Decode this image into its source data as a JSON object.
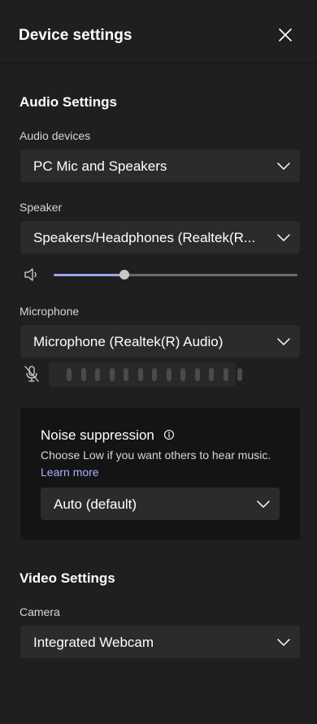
{
  "header": {
    "title": "Device settings",
    "close_icon": "close-icon"
  },
  "audio": {
    "heading": "Audio Settings",
    "devices": {
      "label": "Audio devices",
      "value": "PC Mic and Speakers"
    },
    "speaker": {
      "label": "Speaker",
      "value": "Speakers/Headphones (Realtek(R...",
      "volume_level": 0.29,
      "icon": "speaker-icon"
    },
    "microphone": {
      "label": "Microphone",
      "value": "Microphone (Realtek(R) Audio)",
      "icon": "mic-muted-icon",
      "level_bar_count": 13,
      "level_active": 0
    }
  },
  "noise_suppression": {
    "title": "Noise suppression",
    "description": "Choose Low if you want others to hear music.",
    "learn_more": "Learn more",
    "value": "Auto (default)",
    "info_icon": "info-icon"
  },
  "video": {
    "heading": "Video Settings",
    "camera": {
      "label": "Camera",
      "value": "Integrated Webcam"
    }
  },
  "colors": {
    "background": "#1f1f1f",
    "control": "#2b2b2b",
    "card": "#141414",
    "accent": "#9ea3f5",
    "link": "#aab0ff"
  }
}
